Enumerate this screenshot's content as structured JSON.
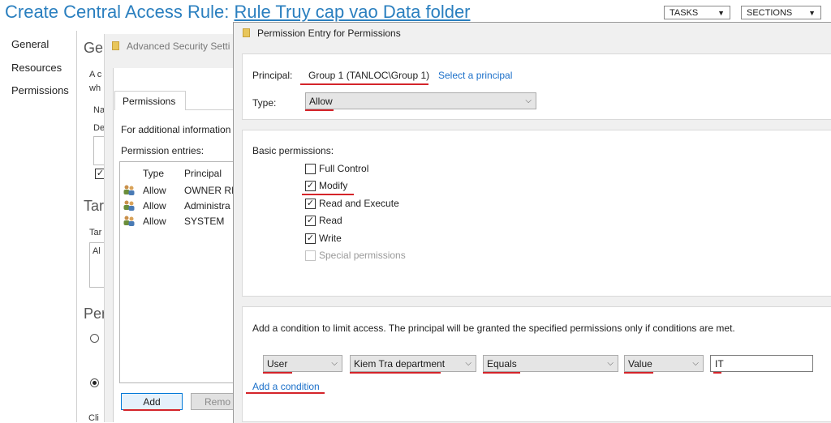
{
  "header": {
    "title_prefix": "Create Central Access Rule: ",
    "title_rule": "Rule Truy cap vao Data folder",
    "tasks_label": "TASKS",
    "sections_label": "SECTIONS"
  },
  "nav": {
    "items": [
      "General",
      "Resources",
      "Permissions"
    ]
  },
  "background": {
    "ge": "Ge",
    "a_c": "A c",
    "wh": "wh",
    "na": "Na",
    "de": "De",
    "tar": "Tar",
    "tar_small": "Tar",
    "al": "Al",
    "per": "Per",
    "cli": "Cli"
  },
  "advanced": {
    "title": "Advanced Security Setti",
    "tab": "Permissions",
    "info": "For additional information",
    "entries_label": "Permission entries:",
    "col_type": "Type",
    "col_principal": "Principal",
    "rows": [
      {
        "type": "Allow",
        "principal": "OWNER RIG"
      },
      {
        "type": "Allow",
        "principal": "Administra"
      },
      {
        "type": "Allow",
        "principal": "SYSTEM"
      }
    ],
    "add_label": "Add",
    "remove_label": "Remo"
  },
  "entry": {
    "title": "Permission Entry for Permissions",
    "principal_label": "Principal:",
    "principal_value": "Group 1 (TANLOC\\Group 1)",
    "select_principal": "Select a principal",
    "type_label": "Type:",
    "type_value": "Allow",
    "basic_label": "Basic permissions:",
    "permissions": [
      {
        "label": "Full Control",
        "checked": false,
        "disabled": false
      },
      {
        "label": "Modify",
        "checked": true,
        "disabled": false
      },
      {
        "label": "Read and Execute",
        "checked": true,
        "disabled": false
      },
      {
        "label": "Read",
        "checked": true,
        "disabled": false
      },
      {
        "label": "Write",
        "checked": true,
        "disabled": false
      },
      {
        "label": "Special permissions",
        "checked": false,
        "disabled": true
      }
    ],
    "condition_text": "Add a condition to limit access. The principal will be granted the specified permissions only if conditions are met.",
    "condition": {
      "subject": "User",
      "attribute": "Kiem Tra department",
      "operator": "Equals",
      "value_type": "Value",
      "value": "IT"
    },
    "add_condition": "Add a condition"
  },
  "colors": {
    "accent": "#2a7fbf",
    "link": "#1a6fc9",
    "annotation": "#d4242a"
  }
}
